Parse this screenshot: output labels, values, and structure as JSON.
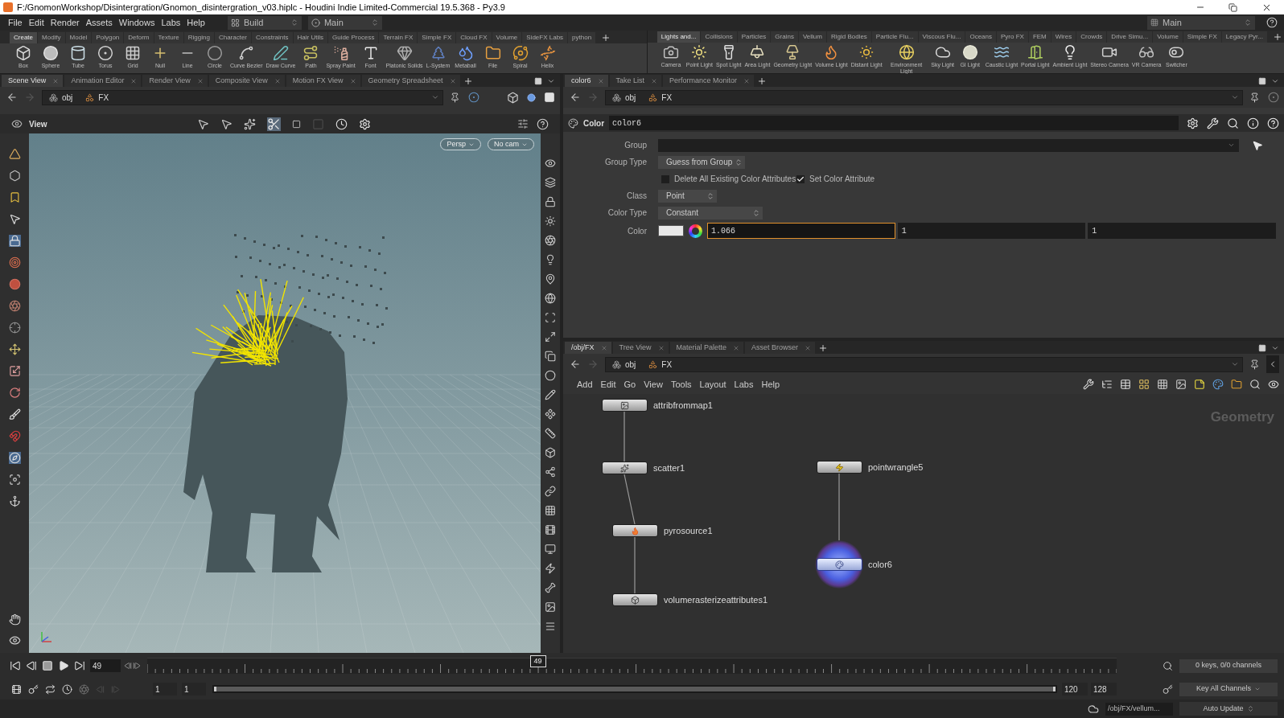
{
  "window": {
    "title": "F:/GnomonWorkshop/Disintergration/Gnomon_disintergration_v03.hiplc - Houdini Indie Limited-Commercial 19.5.368 - Py3.9"
  },
  "menu_bar": {
    "items": [
      "File",
      "Edit",
      "Render",
      "Assets",
      "Windows",
      "Labs",
      "Help"
    ],
    "desktop": "Build",
    "shelf_set": "Main",
    "right_shelf_set": "Main"
  },
  "shelves": [
    {
      "tabs": [
        {
          "label": "Create",
          "selected": true
        },
        {
          "label": "Modify",
          "selected": false
        },
        {
          "label": "Model",
          "selected": false
        },
        {
          "label": "Polygon",
          "selected": false
        },
        {
          "label": "Deform",
          "selected": false
        },
        {
          "label": "Texture",
          "selected": false
        },
        {
          "label": "Rigging",
          "selected": false
        },
        {
          "label": "Character",
          "selected": false
        },
        {
          "label": "Constraints",
          "selected": false
        },
        {
          "label": "Hair Utils",
          "selected": false
        },
        {
          "label": "Guide Process",
          "selected": false
        },
        {
          "label": "Terrain FX",
          "selected": false
        },
        {
          "label": "Simple FX",
          "selected": false
        },
        {
          "label": "Cloud FX",
          "selected": false
        },
        {
          "label": "Volume",
          "selected": false
        },
        {
          "label": "SideFX Labs",
          "selected": false
        },
        {
          "label": "python",
          "selected": false
        }
      ],
      "tools": [
        "Box",
        "Sphere",
        "Tube",
        "Torus",
        "Grid",
        "Null",
        "Line",
        "Circle",
        "Curve Bezier",
        "Draw Curve",
        "Path",
        "Spray Paint",
        "Font",
        "Platonic Solids",
        "L-System",
        "Metaball",
        "File",
        "Spiral",
        "Helix"
      ]
    },
    {
      "tabs": [
        {
          "label": "Lights and...",
          "selected": true
        },
        {
          "label": "Collisions",
          "selected": false
        },
        {
          "label": "Particles",
          "selected": false
        },
        {
          "label": "Grains",
          "selected": false
        },
        {
          "label": "Vellum",
          "selected": false
        },
        {
          "label": "Rigid Bodies",
          "selected": false
        },
        {
          "label": "Particle Flu...",
          "selected": false
        },
        {
          "label": "Viscous Flu...",
          "selected": false
        },
        {
          "label": "Oceans",
          "selected": false
        },
        {
          "label": "Pyro FX",
          "selected": false
        },
        {
          "label": "FEM",
          "selected": false
        },
        {
          "label": "Wires",
          "selected": false
        },
        {
          "label": "Crowds",
          "selected": false
        },
        {
          "label": "Drive Simu...",
          "selected": false
        },
        {
          "label": "Volume",
          "selected": false
        },
        {
          "label": "Simple FX",
          "selected": false
        },
        {
          "label": "Legacy Pyr...",
          "selected": false
        }
      ],
      "tools": [
        "Camera",
        "Point Light",
        "Spot Light",
        "Area Light",
        "Geometry Light",
        "Volume Light",
        "Distant Light",
        "Environment Light",
        "Sky Light",
        "GI Light",
        "Caustic Light",
        "Portal Light",
        "Ambient Light",
        "Stereo Camera",
        "VR Camera",
        "Switcher"
      ]
    }
  ],
  "scene_pane": {
    "tabs": [
      {
        "label": "Scene View",
        "selected": true
      },
      {
        "label": "Animation Editor",
        "selected": false
      },
      {
        "label": "Render View",
        "selected": false
      },
      {
        "label": "Composite View",
        "selected": false
      },
      {
        "label": "Motion FX View",
        "selected": false
      },
      {
        "label": "Geometry Spreadsheet",
        "selected": false
      }
    ],
    "path": [
      "obj",
      "FX"
    ],
    "viewport": {
      "title": "View",
      "menus": [
        "Persp",
        "No cam"
      ]
    }
  },
  "parameter_pane": {
    "tabs": [
      {
        "label": "color6",
        "selected": true
      },
      {
        "label": "Take List",
        "selected": false
      },
      {
        "label": "Performance Monitor",
        "selected": false
      }
    ],
    "path": [
      "obj",
      "FX"
    ],
    "node_type": "Color",
    "node_name": "color6",
    "params": [
      {
        "kind": "text",
        "label": "Group"
      },
      {
        "kind": "menu",
        "label": "Group Type",
        "value": "Guess from Group"
      },
      {
        "kind": "toggles",
        "items": [
          {
            "label": "Delete All Existing Color Attributes",
            "checked": false
          },
          {
            "label": "Set Color Attribute",
            "checked": true
          }
        ]
      },
      {
        "kind": "menu",
        "label": "Class",
        "value": "Point"
      },
      {
        "kind": "menu",
        "label": "Color Type",
        "value": "Constant"
      },
      {
        "kind": "color",
        "label": "Color",
        "values": [
          {
            "value": "1.066",
            "focused": true
          },
          {
            "value": "1",
            "focused": false
          },
          {
            "value": "1",
            "focused": false
          }
        ]
      }
    ]
  },
  "network_pane": {
    "tabs": [
      {
        "label": "/obj/FX",
        "selected": true
      },
      {
        "label": "Tree View",
        "selected": false
      },
      {
        "label": "Material Palette",
        "selected": false
      },
      {
        "label": "Asset Browser",
        "selected": false
      }
    ],
    "path": [
      "obj",
      "FX"
    ],
    "menu": [
      "Add",
      "Edit",
      "Go",
      "View",
      "Tools",
      "Layout",
      "Labs",
      "Help"
    ],
    "context": "Geometry",
    "chains": [
      {
        "nodes": [
          {
            "name": "attribfrommap1",
            "selected": false
          },
          {
            "name": "scatter1",
            "selected": false
          },
          {
            "name": "pyrosource1",
            "selected": false
          },
          {
            "name": "volumerasterizeattributes1",
            "selected": false
          }
        ]
      },
      {
        "nodes": [
          {
            "name": "pointwrangle5",
            "selected": false
          },
          {
            "name": "color6",
            "selected": true
          }
        ]
      }
    ]
  },
  "timeline": {
    "frame": "49",
    "playhead": {
      "label": "49",
      "level": 0.403
    },
    "range": [
      "1",
      "1",
      "120",
      "128"
    ],
    "range_bar": {
      "level": 1
    },
    "keys_info": "0 keys, 0/0 channels",
    "key_menu": "Key All Channels"
  },
  "status_bar": {
    "path": "/obj/FX/vellum...",
    "update_mode": "Auto Update"
  }
}
